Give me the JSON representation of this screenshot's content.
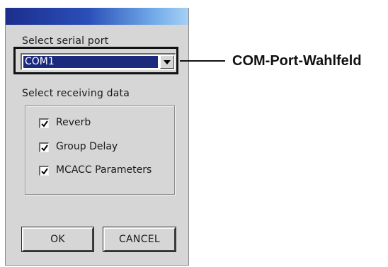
{
  "dialog": {
    "serial_port_label": "Select serial port",
    "com_port": {
      "selected": "COM1"
    },
    "receiving_label": "Select receiving data",
    "options": [
      {
        "label": "Reverb",
        "checked": true
      },
      {
        "label": "Group Delay",
        "checked": true
      },
      {
        "label": "MCACC Parameters",
        "checked": true
      }
    ],
    "ok_label": "OK",
    "cancel_label": "CANCEL"
  },
  "callout": {
    "label": "COM-Port-Wahlfeld"
  },
  "colors": {
    "titlebar_start": "#1b2e8c",
    "titlebar_end": "#a6d0f4",
    "selection": "#1c2a7e",
    "dialog_bg": "#d6d6d6"
  },
  "icons": {
    "dropdown": "chevron-down-icon",
    "check": "checkmark-icon"
  }
}
